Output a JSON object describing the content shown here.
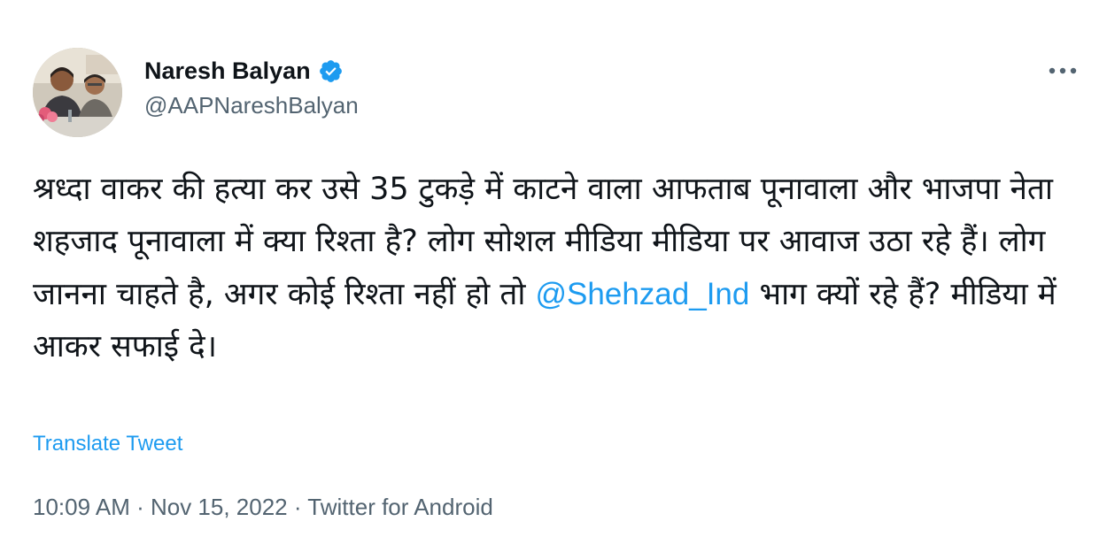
{
  "author": {
    "display_name": "Naresh Balyan",
    "handle": "@AAPNareshBalyan",
    "verified": true,
    "avatar_icon": "profile-photo"
  },
  "tweet": {
    "text_before_mention": "श्रध्दा वाकर की हत्या कर उसे 35 टुकड़े में काटने वाला आफताब पूनावाला और भाजपा नेता शहजाद पूनावाला में क्या रिश्ता है? लोग सोशल मीडिया मीडिया पर आवाज उठा रहे हैं। लोग जानना चाहते है, अगर कोई रिश्ता नहीं हो तो ",
    "mention": "@Shehzad_Ind",
    "text_after_mention": " भाग क्यों रहे हैं? मीडिया में आकर सफाई दे।",
    "translate_label": "Translate Tweet"
  },
  "meta": {
    "time": "10:09 AM",
    "separator": " · ",
    "date": "Nov 15, 2022",
    "source": "Twitter for Android"
  },
  "icons": {
    "verified": "verified-badge-icon",
    "more": "more-options-icon"
  },
  "colors": {
    "text": "#0f1419",
    "secondary_text": "#536471",
    "link": "#1d9bf0",
    "verified_badge": "#1d9bf0",
    "background": "#ffffff"
  }
}
